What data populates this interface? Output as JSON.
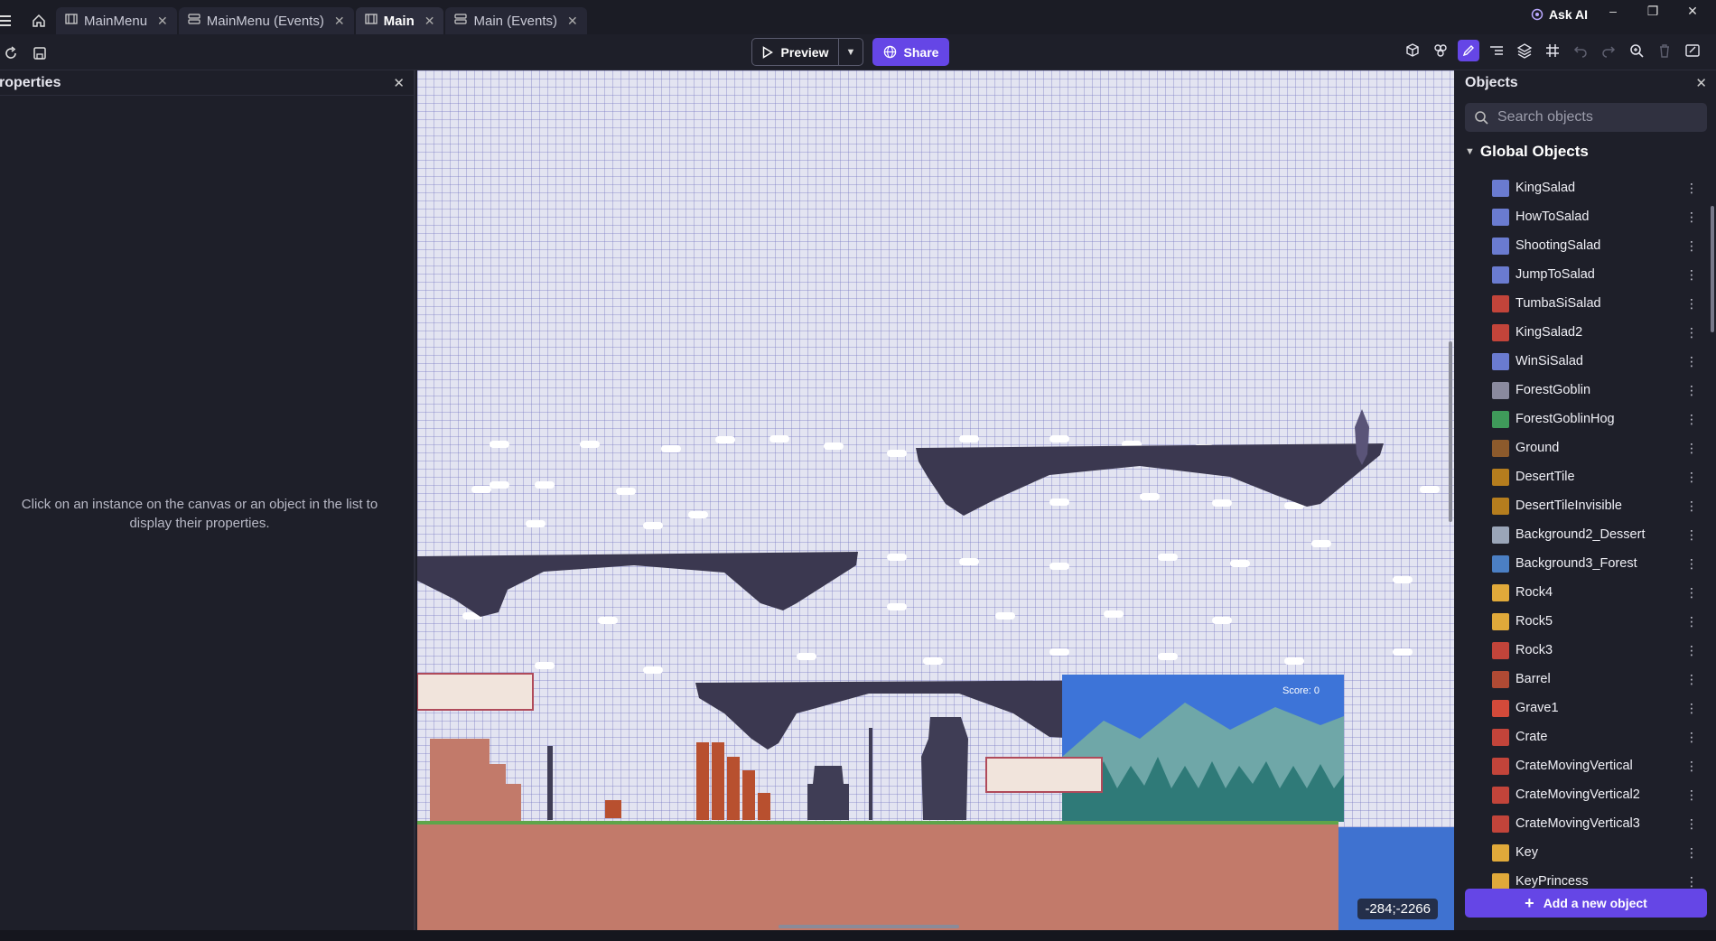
{
  "tabs": [
    {
      "label": "MainMenu",
      "icon": "scene-icon",
      "active": false
    },
    {
      "label": "MainMenu (Events)",
      "icon": "events-icon",
      "active": false
    },
    {
      "label": "Main",
      "icon": "scene-icon",
      "active": true
    },
    {
      "label": "Main (Events)",
      "icon": "events-icon",
      "active": false
    }
  ],
  "ask_ai": "Ask AI",
  "toolbar": {
    "preview_label": "Preview",
    "share_label": "Share"
  },
  "properties": {
    "title": "roperties",
    "hint": "Click on an instance on the canvas or an object in the list to display their properties."
  },
  "canvas": {
    "coordinates": "-284;-2266"
  },
  "objects_panel": {
    "title": "Objects",
    "search_placeholder": "Search objects",
    "group_label": "Global Objects",
    "add_button": "Add a new object",
    "items": [
      {
        "name": "KingSalad",
        "color": "#6a7bd0"
      },
      {
        "name": "HowToSalad",
        "color": "#6a7bd0"
      },
      {
        "name": "ShootingSalad",
        "color": "#6a7bd0"
      },
      {
        "name": "JumpToSalad",
        "color": "#6a7bd0"
      },
      {
        "name": "TumbaSiSalad",
        "color": "#c2443a"
      },
      {
        "name": "KingSalad2",
        "color": "#c2443a"
      },
      {
        "name": "WinSiSalad",
        "color": "#6a7bd0"
      },
      {
        "name": "ForestGoblin",
        "color": "#8a8a9e"
      },
      {
        "name": "ForestGoblinHog",
        "color": "#3f9a5a"
      },
      {
        "name": "Ground",
        "color": "#8c5a2c"
      },
      {
        "name": "DesertTile",
        "color": "#b57d1e"
      },
      {
        "name": "DesertTileInvisible",
        "color": "#b57d1e"
      },
      {
        "name": "Background2_Dessert",
        "color": "#9aa5b8"
      },
      {
        "name": "Background3_Forest",
        "color": "#4b7fc4"
      },
      {
        "name": "Rock4",
        "color": "#e0a93a"
      },
      {
        "name": "Rock5",
        "color": "#e0a93a"
      },
      {
        "name": "Rock3",
        "color": "#c2443a"
      },
      {
        "name": "Barrel",
        "color": "#b04a34"
      },
      {
        "name": "Grave1",
        "color": "#d24a3a"
      },
      {
        "name": "Crate",
        "color": "#c2443a"
      },
      {
        "name": "CrateMovingVertical",
        "color": "#c2443a"
      },
      {
        "name": "CrateMovingVertical2",
        "color": "#c2443a"
      },
      {
        "name": "CrateMovingVertical3",
        "color": "#c2443a"
      },
      {
        "name": "Key",
        "color": "#e0a93a"
      },
      {
        "name": "KeyPrincess",
        "color": "#e0a93a"
      }
    ]
  },
  "scene": {
    "sign_text": "Score: 0"
  }
}
